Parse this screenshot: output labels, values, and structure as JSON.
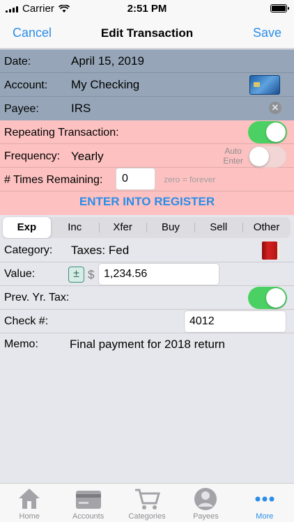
{
  "status_bar": {
    "carrier": "Carrier",
    "time": "2:51 PM"
  },
  "nav": {
    "cancel": "Cancel",
    "title": "Edit Transaction",
    "save": "Save"
  },
  "fields": {
    "date_label": "Date:",
    "date_value": "April 15, 2019",
    "account_label": "Account:",
    "account_value": "My Checking",
    "payee_label": "Payee:",
    "payee_value": "IRS"
  },
  "repeat": {
    "repeating_label": "Repeating Transaction:",
    "repeating_on": true,
    "frequency_label": "Frequency:",
    "frequency_value": "Yearly",
    "auto_enter_label_1": "Auto",
    "auto_enter_label_2": "Enter",
    "auto_enter_on": false,
    "times_label": "# Times Remaining:",
    "times_value": "0",
    "times_hint": "zero = forever",
    "register_button": "ENTER INTO REGISTER"
  },
  "segments": [
    "Exp",
    "Inc",
    "Xfer",
    "Buy",
    "Sell",
    "Other"
  ],
  "segment_selected": "Exp",
  "details": {
    "category_label": "Category:",
    "category_value": "Taxes: Fed",
    "value_label": "Value:",
    "currency": "$",
    "plusminus": "±",
    "value_value": "1,234.56",
    "prev_tax_label": "Prev. Yr. Tax:",
    "prev_tax_on": true,
    "check_label": "Check #:",
    "check_value": "4012",
    "memo_label": "Memo:",
    "memo_value": "Final payment for 2018 return"
  },
  "tabs": [
    {
      "label": "Home",
      "icon": "house-icon"
    },
    {
      "label": "Accounts",
      "icon": "card-icon"
    },
    {
      "label": "Categories",
      "icon": "cart-icon"
    },
    {
      "label": "Payees",
      "icon": "person-icon"
    },
    {
      "label": "More",
      "icon": "more-icon"
    }
  ],
  "colors": {
    "accent": "#2b8de8",
    "toggle_on": "#4bd163",
    "repeat_bg": "#fdc1c1",
    "header_bg": "#96a6b8"
  }
}
